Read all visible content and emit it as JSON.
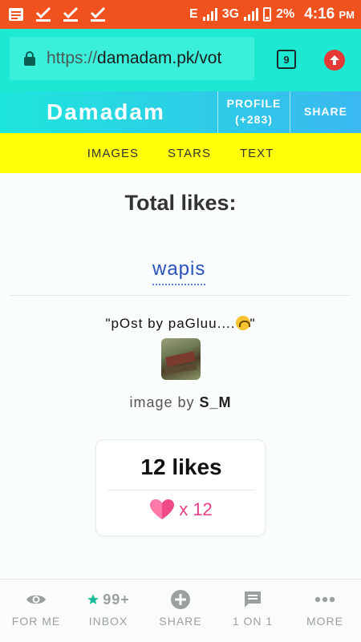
{
  "status_bar": {
    "network": "E",
    "network2": "3G",
    "battery": "2%",
    "time": "4:16",
    "ampm": "PM"
  },
  "browser": {
    "url_scheme": "https://",
    "url_host": "damadam.pk/vot",
    "tab_count": "9"
  },
  "header": {
    "brand": "Damadam",
    "profile_label": "PROFILE",
    "profile_count": "(+283)",
    "share_label": "SHARE"
  },
  "nav": {
    "items": [
      "IMAGES",
      "STARS",
      "TEXT"
    ]
  },
  "content": {
    "title": "Total likes:",
    "back_link": "wapis",
    "caption": "\"pOst by paGluu....",
    "caption_end": "\"",
    "image_by_prefix": "image by ",
    "image_by_user": "S_M",
    "likes_count": "12 likes",
    "likes_multiplier": "x 12"
  },
  "bottom_nav": {
    "items": [
      {
        "label": "FOR ME",
        "icon": "eye-icon"
      },
      {
        "label": "INBOX",
        "icon": "star-icon",
        "badge": "99+"
      },
      {
        "label": "SHARE",
        "icon": "plus-circle-icon"
      },
      {
        "label": "1 ON 1",
        "icon": "chat-icon"
      },
      {
        "label": "MORE",
        "icon": "more-dots-icon"
      }
    ]
  },
  "colors": {
    "status_bar": "#f0521e",
    "url_bar": "#1de9d2",
    "nav_bar": "#ffff05",
    "link": "#2a52be",
    "like_pink": "#e83f86"
  }
}
